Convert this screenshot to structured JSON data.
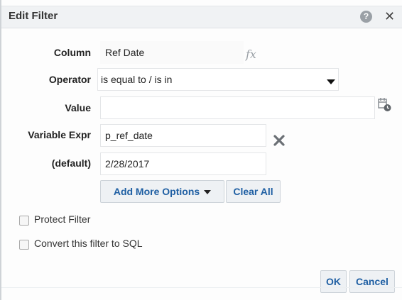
{
  "dialog": {
    "title": "Edit Filter",
    "help_icon_text": "?",
    "close_icon_text": "✕"
  },
  "form": {
    "column_label": "Column",
    "column_value": "Ref Date",
    "fx_label": "fx",
    "operator_label": "Operator",
    "operator_value": "is equal to / is in",
    "value_label": "Value",
    "value_value": "",
    "variable_expr_label": "Variable Expr",
    "variable_expr_value": "p_ref_date",
    "default_label": "(default)",
    "default_value": "2/28/2017"
  },
  "buttons": {
    "add_more_options": "Add More Options",
    "clear_all": "Clear All",
    "ok": "OK",
    "cancel": "Cancel"
  },
  "options": {
    "protect_filter": "Protect Filter",
    "convert_to_sql": "Convert this filter to SQL"
  },
  "icons": {
    "help": "help-icon",
    "close": "close-icon",
    "fx": "fx-icon",
    "calendar": "calendar-icon",
    "remove": "remove-x-icon",
    "dropdown": "chevron-down-icon"
  },
  "colors": {
    "titlebar_bg": "#f0f2f4",
    "button_text": "#1f5fa3",
    "button_bg": "#eef1f4"
  }
}
